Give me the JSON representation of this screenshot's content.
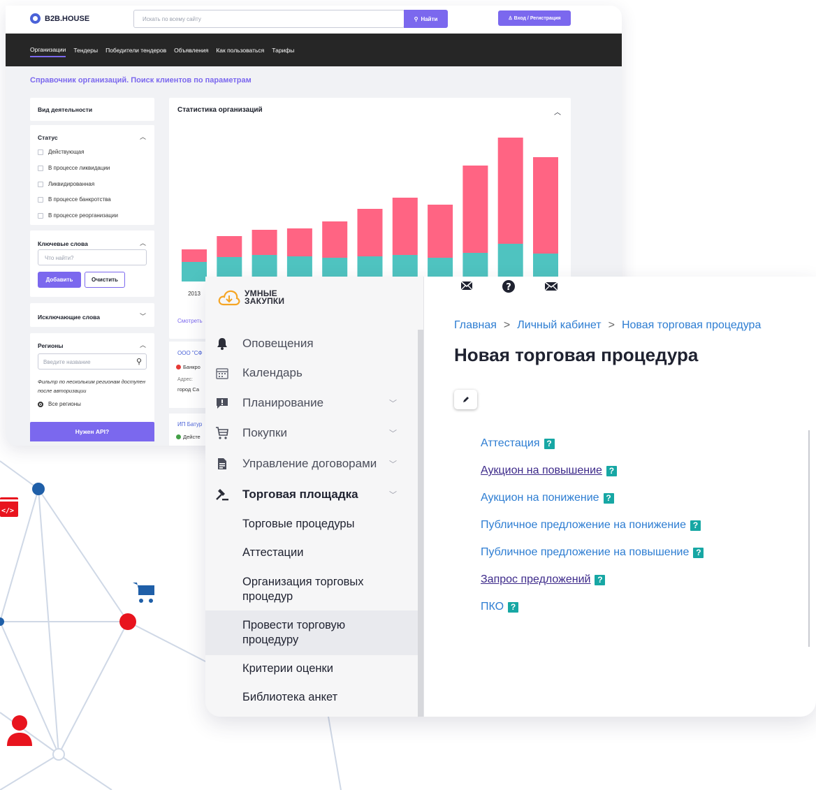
{
  "b2b": {
    "logo": "B2B.HOUSE",
    "search_placeholder": "Искать по всему сайту",
    "search_button": "Найти",
    "login_button": "Вход / Регистрация",
    "nav": [
      "Организации",
      "Тендеры",
      "Победители тендеров",
      "Объявления",
      "Как пользоваться",
      "Тарифы"
    ],
    "heading": "Справочник организаций. Поиск клиентов по параметрам",
    "filters": {
      "activity": "Вид деятельности",
      "status_title": "Статус",
      "statuses": [
        "Действующая",
        "В процессе ликвидации",
        "Ликвидированная",
        "В процессе банкротства",
        "В процессе реорганизации"
      ],
      "keywords_title": "Ключевые слова",
      "keywords_placeholder": "Что найти?",
      "add_button": "Добавить",
      "clear_button": "Очистить",
      "exclude_title": "Исключающие слова",
      "regions_title": "Регионы",
      "regions_placeholder": "Введите название",
      "regions_note": "Фильтр по нескольким регионам доступен после авторизации",
      "all_regions": "Все регионы",
      "api_button": "Нужен API?"
    },
    "chart_title": "Статистика организаций",
    "more_link": "Смотреть",
    "orgs": [
      {
        "name": "ООО \"СФ",
        "status": "Банкро",
        "status_color": "#e53935",
        "meta": "Адрес:",
        "city": "город Са"
      },
      {
        "name": "ИП Батур",
        "status": "Дейсте",
        "status_color": "#43a047"
      }
    ],
    "chart_data": {
      "type": "bar",
      "categories": [
        "2013",
        "",
        "",
        "",
        "",
        "",
        "",
        "",
        "",
        "",
        ""
      ],
      "series": [
        {
          "values": [
            28,
            35,
            38,
            36,
            34,
            36,
            38,
            34,
            41,
            54,
            40
          ],
          "color": "#4fc3c0"
        },
        {
          "values": [
            18,
            30,
            36,
            40,
            52,
            68,
            82,
            76,
            125,
            152,
            138
          ],
          "color": "#ff6483"
        }
      ],
      "ylim": [
        0,
        220
      ]
    }
  },
  "sz": {
    "logo_line1": "УМНЫЕ",
    "logo_line2": "ЗАКУПКИ",
    "menu": [
      {
        "label": "Оповещения",
        "icon": "bell-icon",
        "chevron": false
      },
      {
        "label": "Календарь",
        "icon": "calendar-icon",
        "chevron": false
      },
      {
        "label": "Планирование",
        "icon": "planning-icon",
        "chevron": true
      },
      {
        "label": "Покупки",
        "icon": "cart-icon",
        "chevron": true
      },
      {
        "label": "Управление договорами",
        "icon": "document-icon",
        "chevron": true
      },
      {
        "label": "Торговая площадка",
        "icon": "gavel-icon",
        "chevron": true
      }
    ],
    "submenu": [
      "Торговые процедуры",
      "Аттестации",
      "Организация торговых процедур",
      "Провести торговую процедуру",
      "Критерии оценки",
      "Библиотека анкет"
    ],
    "breadcrumb": [
      "Главная",
      "Личный кабинет",
      "Новая торговая процедура"
    ],
    "title": "Новая торговая процедура",
    "procedures": [
      {
        "label": "Аттестация",
        "visited": false
      },
      {
        "label": "Аукцион на повышение",
        "visited": true
      },
      {
        "label": "Аукцион на понижение",
        "visited": false
      },
      {
        "label": "Публичное предложение на понижение",
        "visited": false
      },
      {
        "label": "Публичное предложение на повышение",
        "visited": false
      },
      {
        "label": "Запрос предложений",
        "visited": true
      },
      {
        "label": "ПКО",
        "visited": false
      }
    ],
    "help_mark": "?"
  }
}
